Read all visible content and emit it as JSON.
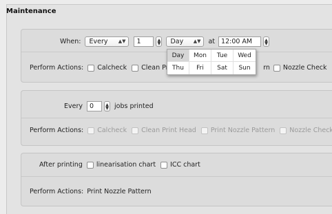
{
  "section_title": "Maintenance",
  "schedule": {
    "when_label": "When:",
    "frequency": "Every",
    "interval": "1",
    "unit": "Day",
    "at_label": "at",
    "time": "12:00 AM",
    "perform_label": "Perform Actions:",
    "actions": [
      "Calcheck",
      "Clean Print Head",
      "Print Nozzle Pattern",
      "Nozzle Check"
    ],
    "visible_fragments": {
      "clean": "Clean Prir",
      "pattern": "rn"
    }
  },
  "day_popup": {
    "days": [
      "Day",
      "Mon",
      "Tue",
      "Wed",
      "Thu",
      "Fri",
      "Sat",
      "Sun"
    ],
    "selected": "Day"
  },
  "jobs": {
    "every_label": "Every",
    "count": "0",
    "suffix": "jobs printed",
    "perform_label": "Perform Actions:",
    "actions": [
      "Calcheck",
      "Clean Print Head",
      "Print Nozzle Pattern",
      "Nozzle Check"
    ]
  },
  "after": {
    "label": "After printing",
    "options": [
      "linearisation chart",
      "ICC chart"
    ],
    "perform_label": "Perform Actions:",
    "perform_value": "Print Nozzle Pattern"
  }
}
